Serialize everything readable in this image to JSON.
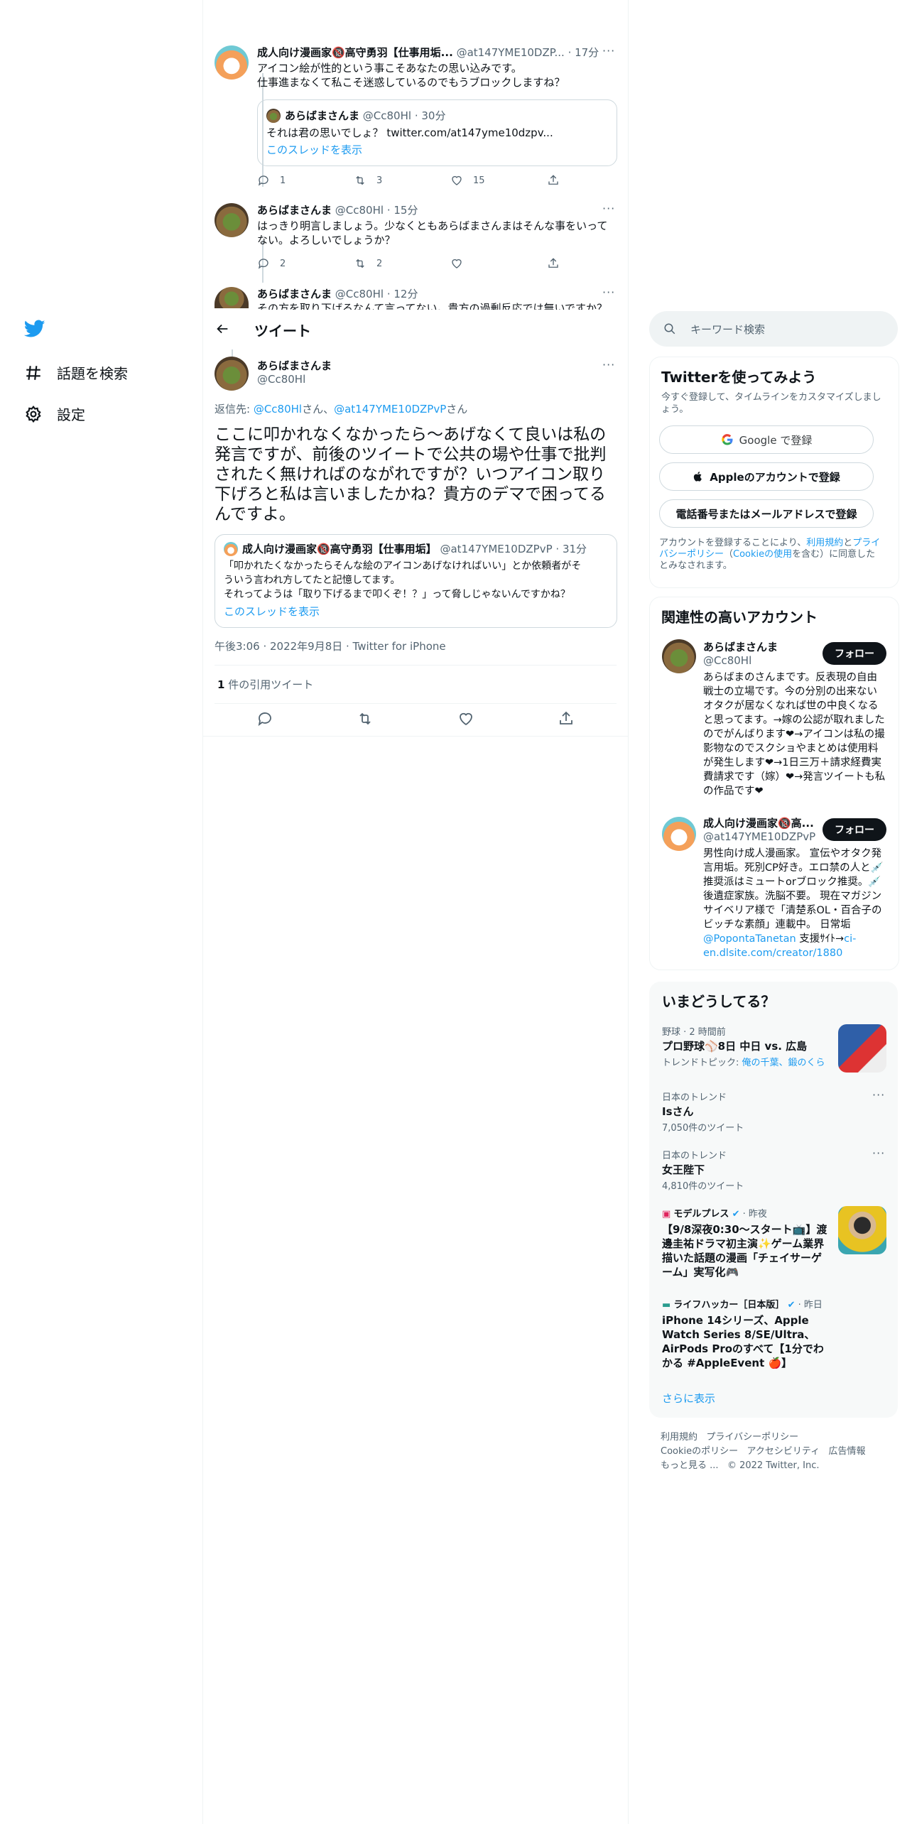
{
  "nav": {
    "explore": "話題を検索",
    "settings": "設定"
  },
  "header": {
    "title": "ツイート"
  },
  "thread": [
    {
      "name": "成人向け漫画家🔞高守勇羽【仕事用垢...",
      "handle": "@at147YME10DZP...",
      "time": "· 17分",
      "lines": [
        "アイコン絵が性的という事こそあなたの思い込みです。",
        "仕事進まなくて私こそ迷惑しているのでもうブロックしますね？"
      ],
      "quote": {
        "name": "あらばまさんま",
        "handle": "@Cc80Hl",
        "time": "· 30分",
        "text": "それは君の思いでしょ？ twitter.com/at147yme10dzpv...",
        "thread_link": "このスレッドを表示"
      },
      "replies": "1",
      "retweets": "3",
      "likes": "15"
    },
    {
      "name": "あらばまさんま",
      "handle": "@Cc80Hl",
      "time": "· 15分",
      "lines": [
        "はっきり明言しましょう。少なくともあらばまさんまはそんな事をいって",
        "ない。よろしいでしょうか？"
      ],
      "replies": "2",
      "retweets": "2",
      "likes": ""
    },
    {
      "name": "あらばまさんま",
      "handle": "@Cc80Hl",
      "time": "· 12分",
      "lines": [
        "その方を取り下げるなんて言ってない。貴方の過剰反応では無いですか？"
      ]
    }
  ],
  "main_tweet": {
    "name": "あらばまさんま",
    "handle": "@Cc80Hl",
    "reply_prefix": "返信先: ",
    "reply_to_1": "@Cc80Hl",
    "reply_mid": "さん、",
    "reply_to_2": "@at147YME10DZPvP",
    "reply_suffix": "さん",
    "text": "ここに叩かれなくなかったら〜あげなくて良いは私の発言ですが、前後のツイートで公共の場や仕事で批判されたく無ければのながれですが？いつアイコン取り下げろと私は言いましたかね？貴方のデマで困ってるんですよ。",
    "quote": {
      "name": "成人向け漫画家🔞高守勇羽【仕事用垢】",
      "handle": "@at147YME10DZPvP",
      "time": "· 31分",
      "line1": "「叩かれたくなかったらそんな絵のアイコンあげなければいい」とか依頼者がそ",
      "line2": "ういう言われ方してたと記憶してます。",
      "line3": "それってようは「取り下げるまで叩くぞ！？」って脅しじゃないんですかね？",
      "thread_link": "このスレッドを表示"
    },
    "meta": "午後3:06 · 2022年9月8日 · Twitter for iPhone",
    "quote_count": "1",
    "quote_label": "件の引用ツイート"
  },
  "sidebar": {
    "search_placeholder": "キーワード検索",
    "signup": {
      "title": "Twitterを使ってみよう",
      "subtitle": "今すぐ登録して、タイムラインをカスタマイズしましょう。",
      "google": "Google で登録",
      "apple": "Appleのアカウントで登録",
      "phone": "電話番号またはメールアドレスで登録",
      "terms_1": "アカウントを登録することにより、",
      "terms_link1": "利用規約",
      "terms_2": "と",
      "terms_link2": "プライバシーポリシー",
      "terms_3": "（",
      "terms_link3": "Cookieの使用",
      "terms_4": "を含む）に同意したとみなされます。"
    },
    "related": {
      "title": "関連性の高いアカウント",
      "accounts": [
        {
          "name": "あらばまさんま",
          "handle": "@Cc80Hl",
          "follow": "フォロー",
          "bio": "あらばまのさんまです。反表現の自由戦士の立場です。今の分別の出来ないオタクが居なくなれば世の中良くなると思ってます。→嫁の公認が取れましたのでがんばります❤→アイコンは私の撮影物なのでスクショやまとめは使用料が発生します❤→1日三万＋請求経費実費請求です（嫁）❤→発言ツイートも私の作品です❤"
        },
        {
          "name": "成人向け漫画家🔞高...",
          "handle": "@at147YME10DZPvP",
          "follow": "フォロー",
          "bio": "男性向け成人漫画家。 宣伝やオタク発言用垢。死別CP好き。エロ禁の人と💉推奨派はミュートorブロック推奨。💉後遺症家族。洗脳不要。 現在マガジンサイベリア様で「清楚系OL・百合子のビッチな素顔」連載中。 日常垢",
          "bio_link": "@PopontaTanetan",
          "bio_tail": " 支援ｻｲﾄ→",
          "bio_url": "ci-en.dlsite.com/creator/1880"
        }
      ]
    },
    "trends": {
      "title": "いまどうしてる？",
      "items": [
        {
          "meta": "野球 · 2 時間前",
          "title": "プロ野球⚾8日 中日 vs. 広島",
          "sub_prefix": "トレンドトピック: ",
          "sub_link": "俺の千葉、鍛のくら"
        },
        {
          "meta": "日本のトレンド",
          "title": "Isさん",
          "count": "7,050件のツイート"
        },
        {
          "meta": "日本のトレンド",
          "title": "女王陛下",
          "count": "4,810件のツイート"
        },
        {
          "source": "モデルプレス",
          "time": "· 昨夜",
          "title": "【9/8深夜0:30～スタート📺】渡邊圭祐ドラマ初主演✨ゲーム業界描いた話題の漫画「チェイサーゲーム」実写化🎮"
        },
        {
          "source": "ライフハッカー［日本版］",
          "time": "· 昨日",
          "title": "iPhone 14シリーズ、Apple Watch Series 8/SE/Ultra、AirPods Proのすべて【1分でわかる #AppleEvent 🍎】"
        }
      ],
      "show_more": "さらに表示"
    },
    "footer": {
      "line1a": "利用規約",
      "line1b": "プライバシーポリシー",
      "line2a": "Cookieのポリシー",
      "line2b": "アクセシビリティ",
      "line2c": "広告情報",
      "line3a": "もっと見る ...",
      "line3b": "© 2022 Twitter, Inc."
    }
  },
  "colors": {
    "accent": "#1d9bf0",
    "text": "#0f1419",
    "muted": "#536471"
  }
}
